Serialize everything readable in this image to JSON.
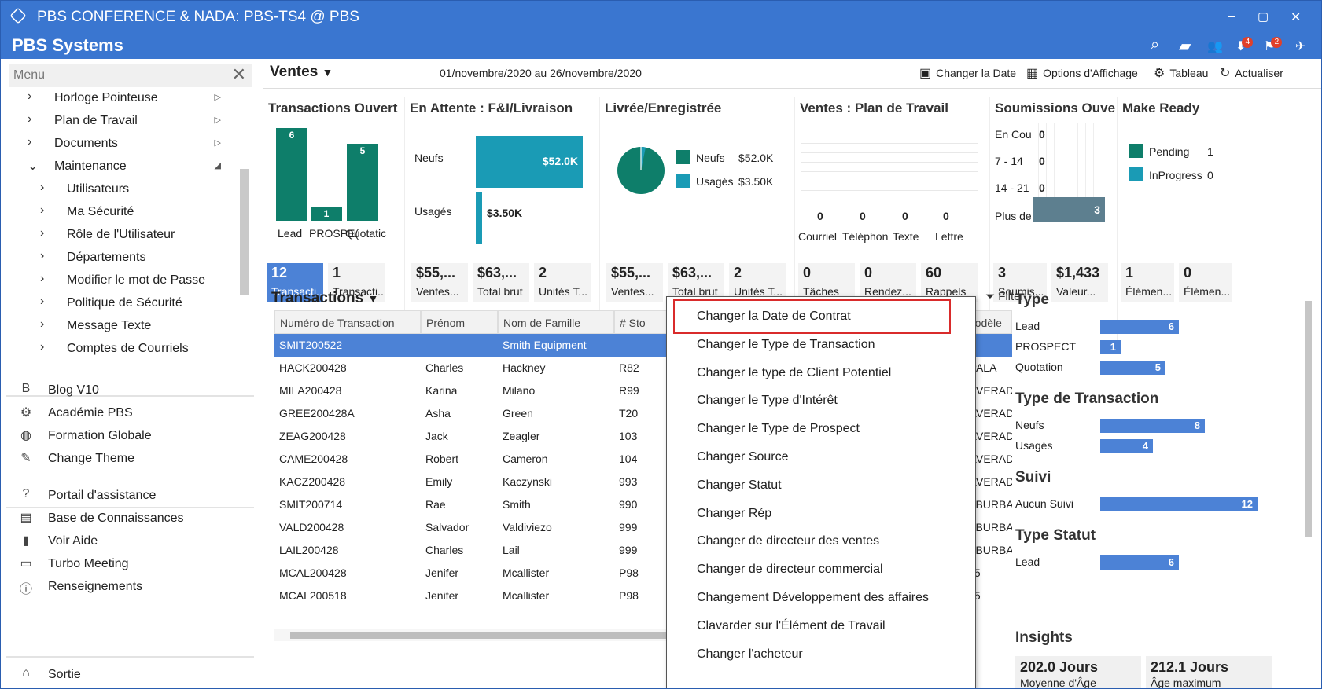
{
  "window": {
    "title": "PBS CONFERENCE & NADA: PBS-TS4 @ PBS",
    "controls": [
      "–",
      "▢",
      "✕"
    ]
  },
  "appbar": {
    "name": "PBS Systems",
    "badges": [
      "4",
      "2"
    ]
  },
  "sidebar": {
    "menu_label": "Menu",
    "tree": [
      {
        "label": "Horloge Pointeuse",
        "level": 0,
        "chev": "›",
        "arrow": "▷"
      },
      {
        "label": "Plan de Travail",
        "level": 0,
        "chev": "›",
        "arrow": "▷"
      },
      {
        "label": "Documents",
        "level": 0,
        "chev": "›",
        "arrow": "▷"
      },
      {
        "label": "Maintenance",
        "level": 0,
        "chev": "⌄",
        "arrow": "◢"
      },
      {
        "label": "Utilisateurs",
        "level": 1,
        "chev": "›"
      },
      {
        "label": "Ma Sécurité",
        "level": 1,
        "chev": "›"
      },
      {
        "label": "Rôle de l'Utilisateur",
        "level": 1,
        "chev": "›"
      },
      {
        "label": "Départements",
        "level": 1,
        "chev": "›"
      },
      {
        "label": "Modifier le mot de Passe",
        "level": 1,
        "chev": "›"
      },
      {
        "label": "Politique de Sécurité",
        "level": 1,
        "chev": "›"
      },
      {
        "label": "Message Texte",
        "level": 1,
        "chev": "›"
      },
      {
        "label": "Comptes de Courriels",
        "level": 1,
        "chev": "›"
      }
    ],
    "links_a": [
      {
        "label": "Blog V10",
        "icon": "B"
      },
      {
        "label": "Académie PBS",
        "icon": "⚙"
      },
      {
        "label": "Formation Globale",
        "icon": "◍"
      },
      {
        "label": "Change Theme",
        "icon": "✎"
      }
    ],
    "links_b": [
      {
        "label": "Portail d'assistance",
        "icon": "?"
      },
      {
        "label": "Base de Connaissances",
        "icon": "▤"
      },
      {
        "label": "Voir Aide",
        "icon": "▮"
      },
      {
        "label": "Turbo Meeting",
        "icon": "▭"
      },
      {
        "label": "Renseignements",
        "icon": "ⓘ"
      }
    ],
    "exit": {
      "label": "Sortie",
      "icon": "⌂"
    }
  },
  "toolbar": {
    "section": "Ventes",
    "daterange": "01/novembre/2020 au 26/novembre/2020",
    "actions": [
      "Changer la Date",
      "Options d'Affichage",
      "Tableau",
      "Actualiser"
    ]
  },
  "cards": {
    "open": {
      "title": "Transactions Ouvert",
      "bars": [
        {
          "label": "Lead",
          "value": 6
        },
        {
          "label": "PROSPECT",
          "value": 1
        },
        {
          "label": "Quotation",
          "value": 5
        }
      ],
      "bar_labels": [
        "6",
        "1",
        "5"
      ],
      "cat_labels": [
        "Lead",
        "PROSPE(",
        "Quotatic"
      ],
      "tiles": [
        {
          "n": "12",
          "l": "Transacti..."
        },
        {
          "n": "1",
          "l": "Transacti..."
        }
      ]
    },
    "pending": {
      "title": "En Attente : F&I/Livraison",
      "rows": [
        {
          "label": "Neufs",
          "value": "$52.0K"
        },
        {
          "label": "Usagés",
          "value": "$3.50K"
        }
      ],
      "tiles": [
        {
          "n": "$55,...",
          "l": "Ventes..."
        },
        {
          "n": "$63,...",
          "l": "Total brut"
        },
        {
          "n": "2",
          "l": "Unités T..."
        }
      ]
    },
    "delivered": {
      "title": "Livrée/Enregistrée",
      "legend": [
        {
          "label": "Neufs",
          "value": "$52.0K",
          "color": "#0e7e6a"
        },
        {
          "label": "Usagés",
          "value": "$3.50K",
          "color": "#1a9bb5"
        }
      ],
      "tiles": [
        {
          "n": "$55,...",
          "l": "Ventes..."
        },
        {
          "n": "$63,...",
          "l": "Total brut"
        },
        {
          "n": "2",
          "l": "Unités T..."
        }
      ]
    },
    "plan": {
      "title": "Ventes : Plan de Travail",
      "values": [
        "0",
        "0",
        "0",
        "0"
      ],
      "labels": [
        "Courriel",
        "Téléphon",
        "Texte",
        "Lettre"
      ],
      "tiles": [
        {
          "n": "0",
          "l": "Tâches"
        },
        {
          "n": "0",
          "l": "Rendez..."
        },
        {
          "n": "60",
          "l": "Rappels"
        }
      ]
    },
    "quotes": {
      "title": "Soumissions Ouve",
      "rows": [
        {
          "label": "En Cou",
          "value": "0"
        },
        {
          "label": "7 - 14",
          "value": "0"
        },
        {
          "label": "14 - 21",
          "value": "0"
        },
        {
          "label": "Plus de",
          "value": "3"
        }
      ],
      "tiles": [
        {
          "n": "3",
          "l": "Soumis..."
        },
        {
          "n": "$1,433",
          "l": "Valeur..."
        }
      ]
    },
    "ready": {
      "title": "Make Ready",
      "rows": [
        {
          "label": "Pending",
          "value": "1"
        },
        {
          "label": "InProgress",
          "value": "0"
        }
      ],
      "tiles": [
        {
          "n": "1",
          "l": "Élémen..."
        },
        {
          "n": "0",
          "l": "Élémen..."
        }
      ]
    }
  },
  "transactions": {
    "title": "Transactions",
    "filter": "Filter",
    "columns": [
      "Numéro de Transaction",
      "Prénom",
      "Nom de Famille",
      "# Sto",
      "Modèle"
    ],
    "rows": [
      {
        "num": "SMIT200522",
        "first": "",
        "last": "Smith Equipment",
        "stock": "",
        "model": ""
      },
      {
        "num": "HACK200428",
        "first": "Charles",
        "last": "Hackney",
        "stock": "R82",
        "model": "MPALA"
      },
      {
        "num": "MILA200428",
        "first": "Karina",
        "last": "Milano",
        "stock": "R99",
        "model": "SILVERADO"
      },
      {
        "num": "GREE200428A",
        "first": "Asha",
        "last": "Green",
        "stock": "T20",
        "model": "SILVERADO"
      },
      {
        "num": "ZEAG200428",
        "first": "Jack",
        "last": "Zeagler",
        "stock": "103",
        "model": "SILVERADO"
      },
      {
        "num": "CAME200428",
        "first": "Robert",
        "last": "Cameron",
        "stock": "104",
        "model": "SILVERADO"
      },
      {
        "num": "KACZ200428",
        "first": "Emily",
        "last": "Kaczynski",
        "stock": "993",
        "model": "SILVERADO"
      },
      {
        "num": "SMIT200714",
        "first": "Rae",
        "last": "Smith",
        "stock": "990",
        "model": "SUBURBAN"
      },
      {
        "num": "VALD200428",
        "first": "Salvador",
        "last": "Valdiviezo",
        "stock": "999",
        "model": "SUBURBAN"
      },
      {
        "num": "LAIL200428",
        "first": "Charles",
        "last": "Lail",
        "stock": "999",
        "model": "SUBURBAN"
      },
      {
        "num": "MCAL200428",
        "first": "Jenifer",
        "last": "Mcallister",
        "stock": "P98",
        "model": "XT5"
      },
      {
        "num": "MCAL200518",
        "first": "Jenifer",
        "last": "Mcallister",
        "stock": "P98",
        "model": "XT5"
      }
    ]
  },
  "right_panel": {
    "groups": [
      {
        "title": "Type",
        "rows": [
          {
            "label": "Lead",
            "value": 6,
            "text": "6"
          },
          {
            "label": "PROSPECT",
            "value": 1,
            "text": "1"
          },
          {
            "label": "Quotation",
            "value": 5,
            "text": "5"
          }
        ]
      },
      {
        "title": "Type de Transaction",
        "rows": [
          {
            "label": "Neufs",
            "value": 8,
            "text": "8"
          },
          {
            "label": "Usagés",
            "value": 4,
            "text": "4"
          }
        ]
      },
      {
        "title": "Suivi",
        "rows": [
          {
            "label": "Aucun Suivi",
            "value": 12,
            "text": "12"
          }
        ]
      },
      {
        "title": "Type Statut",
        "rows": [
          {
            "label": "Lead",
            "value": 6,
            "text": "6"
          }
        ]
      }
    ],
    "insights_title": "Insights",
    "insights": [
      {
        "n": "202.0 Jours",
        "l": "Moyenne d'Âge"
      },
      {
        "n": "212.1 Jours",
        "l": "Âge maximum"
      }
    ]
  },
  "context_menu": {
    "items": [
      "Changer la Date de Contrat",
      "Changer le Type de Transaction",
      "Changer le type de Client Potentiel",
      "Changer le Type d'Intérêt",
      "Changer le Type de Prospect",
      "Changer Source",
      "Changer Statut",
      "Changer Rép",
      "Changer de directeur des ventes",
      "Changer de directeur commercial",
      "Changement Développement des affaires",
      "Clavarder sur l'Élément de Travail",
      "Changer l'acheteur"
    ],
    "highlighted": 0
  },
  "colors": {
    "accent": "#3a76d0",
    "teal": "#0e7e6a",
    "cyan": "#1a9bb5",
    "selection": "#4c82d6",
    "slate": "#5d7f8f",
    "highlight": "#d92b2b"
  }
}
